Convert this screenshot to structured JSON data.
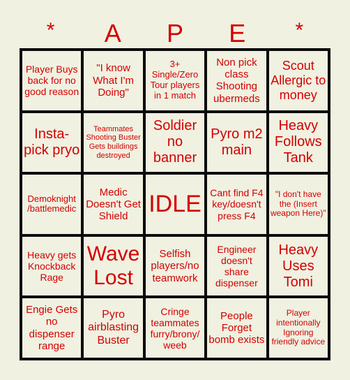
{
  "header": {
    "letters": [
      "*",
      "A",
      "P",
      "E",
      "*"
    ]
  },
  "colors": {
    "background": "#f0f1e1",
    "text": "#d40000",
    "grid_lines": "#0a0a0a"
  },
  "cells": [
    [
      "Player Buys back for no good reason",
      "\"I know What I'm Doing\"",
      "3+ Single/Zero Tour players in 1 match",
      "Non pick class Shooting ubermeds",
      "Scout Allergic to money"
    ],
    [
      "Insta-pick pryo",
      "Teammates Shooting Buster Gets buildings destroyed",
      "Soldier no banner",
      "Pyro m2 main",
      "Heavy Follows Tank"
    ],
    [
      "Demoknight /battlemedic",
      "Medic Doesn't Get Shield",
      "IDLE",
      "Cant find F4 key/doesn't press F4",
      "\"I don't have the (Insert weapon Here)\""
    ],
    [
      "Heavy gets Knockback Rage",
      "Wave Lost",
      "Selfish players/no teamwork",
      "Engineer doesn't share dispenser",
      "Heavy Uses Tomi"
    ],
    [
      "Engie Gets no dispenser range",
      "Pyro airblasting Buster",
      "Cringe teammates furry/brony/ weeb",
      "People Forget bomb exists",
      "Player intentionally Ignoring friendly advice"
    ]
  ]
}
